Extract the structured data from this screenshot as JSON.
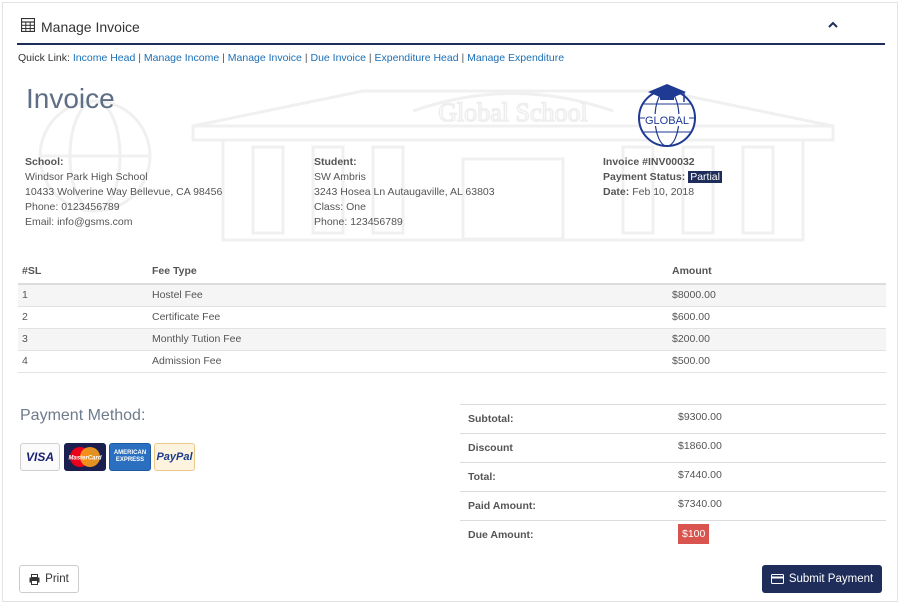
{
  "header": {
    "title": "Manage Invoice",
    "icon": "table-grid-icon",
    "collapse_icon": "chevron-up-icon"
  },
  "quick_links": {
    "label": "Quick Link:",
    "items": [
      "Income Head",
      "Manage Income",
      "Manage Invoice",
      "Due Invoice",
      "Expenditure Head",
      "Manage Expenditure"
    ]
  },
  "invoice": {
    "title": "Invoice",
    "logo_text": "GLOBAL",
    "watermark_text": "Global School"
  },
  "school": {
    "label": "School:",
    "name": "Windsor Park High School",
    "address": "10433 Wolverine Way Bellevue, CA 98456",
    "phone": "Phone: 0123456789",
    "email": "Email: info@gsms.com"
  },
  "student": {
    "label": "Student:",
    "name": "SW Ambris",
    "address": "3243 Hosea Ln Autaugaville, AL 63803",
    "class": "Class: One",
    "phone": "Phone: 123456789"
  },
  "meta": {
    "invoice_no": "Invoice #INV00032",
    "status_label": "Payment Status:",
    "status_value": "Partial",
    "date_label": "Date:",
    "date_value": "Feb 10, 2018"
  },
  "fees": {
    "columns": [
      "#SL",
      "Fee Type",
      "Amount"
    ],
    "rows": [
      {
        "sl": "1",
        "type": "Hostel Fee",
        "amount": "$8000.00"
      },
      {
        "sl": "2",
        "type": "Certificate Fee",
        "amount": "$600.00"
      },
      {
        "sl": "3",
        "type": "Monthly Tution Fee",
        "amount": "$200.00"
      },
      {
        "sl": "4",
        "type": "Admission Fee",
        "amount": "$500.00"
      }
    ]
  },
  "payment": {
    "title": "Payment Method:",
    "cards": [
      "VISA",
      "MasterCard",
      "AMERICAN EXPRESS",
      "PayPal"
    ]
  },
  "totals": [
    {
      "label": "Subtotal:",
      "value": "$9300.00"
    },
    {
      "label": "Discount",
      "value": "$1860.00"
    },
    {
      "label": "Total:",
      "value": "$7440.00"
    },
    {
      "label": "Paid Amount:",
      "value": "$7340.00"
    },
    {
      "label": "Due Amount:",
      "value": "$100"
    }
  ],
  "buttons": {
    "print": "Print",
    "submit": "Submit Payment"
  },
  "colors": {
    "navy": "#1f2d5a",
    "link": "#1b6fb7",
    "due": "#d9534f"
  }
}
